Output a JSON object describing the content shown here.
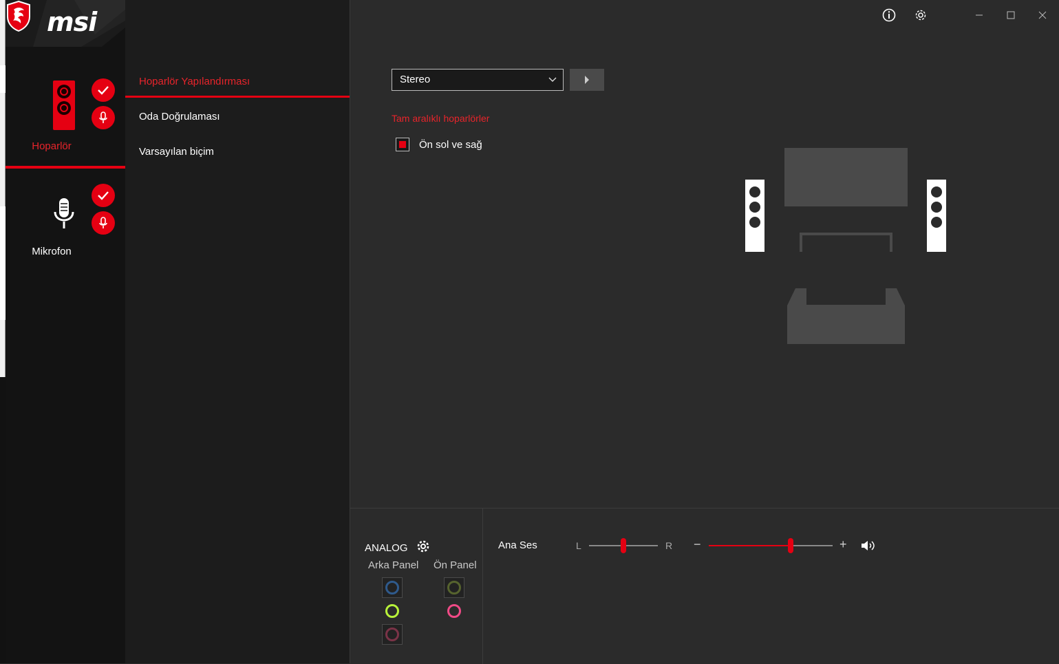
{
  "brand": {
    "name": "msi"
  },
  "devices": [
    {
      "label": "Hoparlör",
      "icon": "speaker-icon",
      "active": true
    },
    {
      "label": "Mikrofon",
      "icon": "microphone-icon",
      "active": false
    }
  ],
  "submenu": {
    "items": [
      {
        "label": "Hoparlör Yapılandırması",
        "active": true
      },
      {
        "label": "Oda Doğrulaması",
        "active": false
      },
      {
        "label": "Varsayılan biçim",
        "active": false
      }
    ]
  },
  "speaker_config": {
    "mode_value": "Stereo",
    "section_title": "Tam aralıklı hoparlörler",
    "checkbox_label": "Ön sol ve sağ",
    "checkbox_checked": true
  },
  "analog": {
    "title": "ANALOG",
    "rear_label": "Arka Panel",
    "front_label": "Ön Panel",
    "rear_jacks": [
      {
        "color": "#2f5a8c",
        "name": "line-in-jack"
      },
      {
        "color": "#b8f23a",
        "name": "line-out-jack"
      },
      {
        "color": "#7a3347",
        "name": "mic-in-jack"
      }
    ],
    "front_jacks": [
      {
        "color": "#56632e",
        "name": "headphone-jack"
      },
      {
        "color": "#f04a86",
        "name": "front-mic-jack"
      }
    ]
  },
  "volume": {
    "label": "Ana Ses",
    "balance_left": "L",
    "balance_right": "R",
    "balance_level": 0.5,
    "minus": "−",
    "plus": "+",
    "master_level": 0.66
  },
  "colors": {
    "accent": "#e50012",
    "accent_text": "#e8242b",
    "background": "#2b2b2b"
  }
}
